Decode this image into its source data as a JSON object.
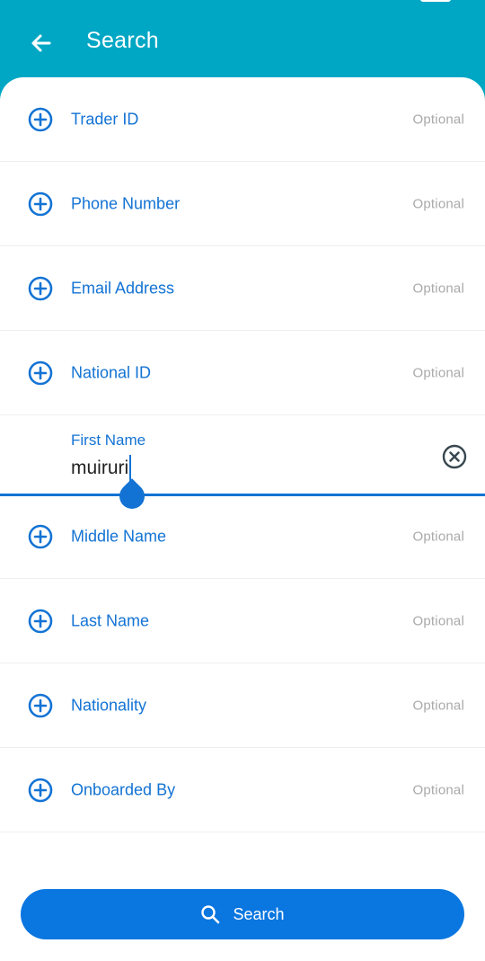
{
  "header": {
    "title": "Search",
    "back_icon": "arrow-left-icon"
  },
  "colors": {
    "header_bg": "#00a7c4",
    "accent": "#1373d4",
    "button_bg": "#0a76e0",
    "optional_text": "#a9a9a9"
  },
  "fields_top": [
    {
      "label": "Trader ID",
      "hint": "Optional",
      "icon": "add-circle-icon"
    },
    {
      "label": "Phone Number",
      "hint": "Optional",
      "icon": "add-circle-icon"
    },
    {
      "label": "Email Address",
      "hint": "Optional",
      "icon": "add-circle-icon"
    },
    {
      "label": "National ID",
      "hint": "Optional",
      "icon": "add-circle-icon"
    }
  ],
  "active_field": {
    "label": "First Name",
    "value": "muiruri",
    "clear_icon": "clear-circle-icon"
  },
  "fields_bottom": [
    {
      "label": "Middle Name",
      "hint": "Optional",
      "icon": "add-circle-icon"
    },
    {
      "label": "Last Name",
      "hint": "Optional",
      "icon": "add-circle-icon"
    },
    {
      "label": "Nationality",
      "hint": "Optional",
      "icon": "add-circle-icon"
    },
    {
      "label": "Onboarded By",
      "hint": "Optional",
      "icon": "add-circle-icon"
    }
  ],
  "search_button": {
    "label": "Search",
    "icon": "search-icon"
  }
}
